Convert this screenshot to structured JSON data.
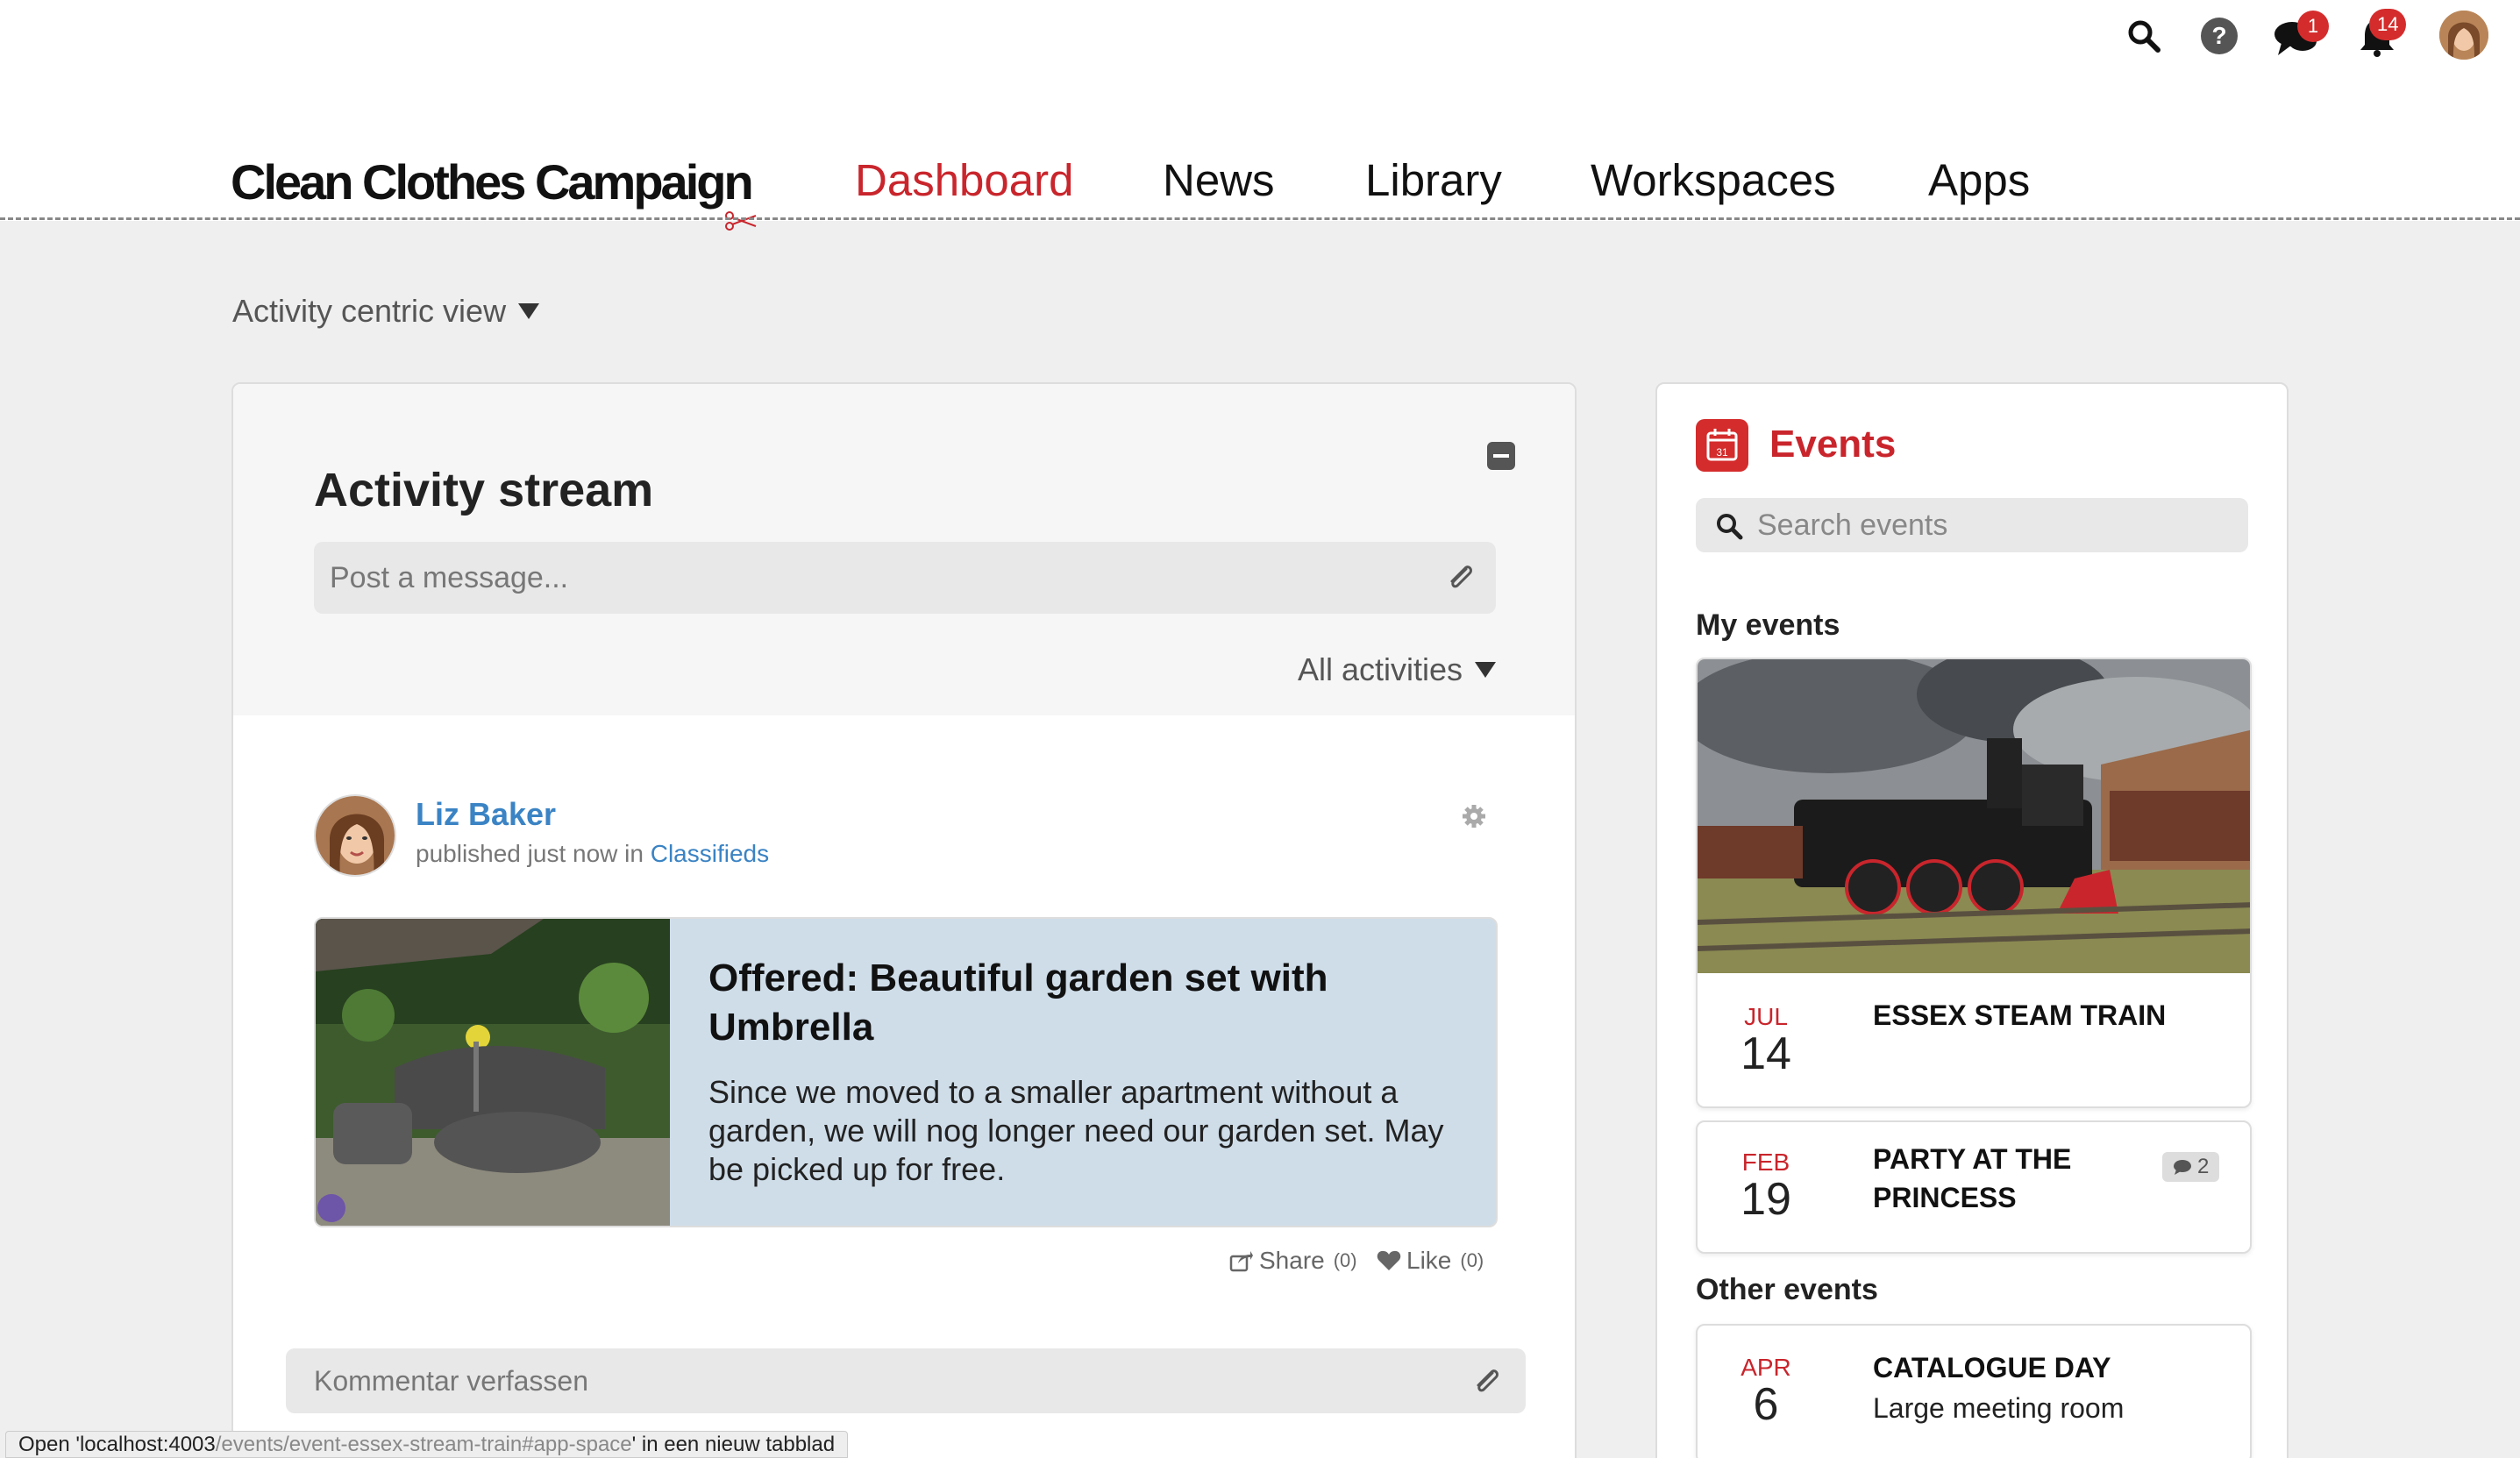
{
  "topbar": {
    "messages_badge": "1",
    "notifications_badge": "14"
  },
  "brand": {
    "logo": "Clean Clothes Campaign"
  },
  "nav": {
    "items": [
      {
        "label": "Dashboard",
        "active": true
      },
      {
        "label": "News"
      },
      {
        "label": "Library"
      },
      {
        "label": "Workspaces"
      },
      {
        "label": "Apps"
      }
    ]
  },
  "view": {
    "label": "Activity centric view"
  },
  "activity": {
    "title": "Activity stream",
    "post_placeholder": "Post a message...",
    "filter_label": "All activities",
    "post": {
      "author": "Liz Baker",
      "meta_prefix": "published just now in",
      "meta_link": "Classifieds",
      "card_title": "Offered: Beautiful garden set with Umbrella",
      "card_text": "Since we moved to a smaller apartment without a garden, we will nog longer need our garden set. May be picked up for free.",
      "share_label": "Share",
      "share_count": "(0)",
      "like_label": "Like",
      "like_count": "(0)"
    },
    "comment_placeholder": "Kommentar verfassen"
  },
  "events": {
    "title": "Events",
    "icon_day": "31",
    "search_placeholder": "Search events",
    "my_events_title": "My events",
    "other_events_title": "Other events",
    "my_events": [
      {
        "month": "JUL",
        "day": "14",
        "name": "ESSEX STEAM TRAIN"
      },
      {
        "month": "FEB",
        "day": "19",
        "name_line1": "PARTY AT THE",
        "name_line2": "PRINCESS",
        "comments": "2"
      }
    ],
    "other_events": [
      {
        "month": "APR",
        "day": "6",
        "name": "CATALOGUE DAY",
        "location": "Large meeting room"
      }
    ]
  },
  "statusbar": {
    "prefix": "Open '",
    "host": "localhost:4003",
    "path": "/events/event-essex-stream-train#app-space",
    "suffix": "' in een nieuw tabblad"
  },
  "colors": {
    "accent_red": "#c9252c",
    "link_blue": "#3a83c4",
    "card_blue": "#cfdde9",
    "page_bg": "#efefef"
  }
}
